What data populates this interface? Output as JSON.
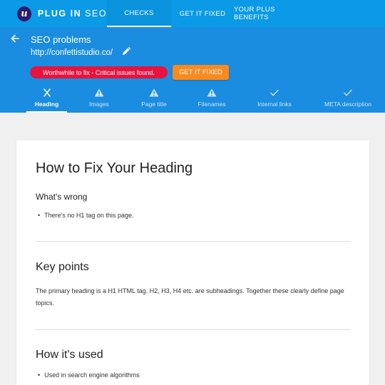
{
  "app": {
    "logo_letter": "u",
    "brand_bold": "PLUG IN",
    "brand_rest": "SEO"
  },
  "topnav": {
    "items": [
      {
        "label": "CHECKS",
        "active": true
      },
      {
        "label": "GET IT FIXED",
        "active": false
      },
      {
        "label": "YOUR PLUS BENEFITS",
        "active": false
      }
    ]
  },
  "header": {
    "title": "SEO problems",
    "url": "http://confettistudio.co/",
    "status_badge": "Worthwhile to fix - Critical issues found.",
    "fix_button": "GET IT FIXED"
  },
  "tabs": [
    {
      "label": "Heading",
      "icon": "close-icon",
      "active": true
    },
    {
      "label": "Images",
      "icon": "warning-icon",
      "active": false
    },
    {
      "label": "Page title",
      "icon": "warning-icon",
      "active": false
    },
    {
      "label": "Filenames",
      "icon": "warning-icon",
      "active": false
    },
    {
      "label": "Internal links",
      "icon": "check-icon",
      "active": false
    },
    {
      "label": "META description",
      "icon": "check-icon",
      "active": false
    }
  ],
  "content": {
    "title": "How to Fix Your Heading",
    "whats_wrong": {
      "heading": "What's wrong",
      "items": [
        "There's no H1 tag on this page."
      ]
    },
    "key_points": {
      "heading": "Key points",
      "text": "The primary heading is a H1 HTML tag. H2, H3, H4 etc. are subheadings. Together these clearly define page topics."
    },
    "how_used": {
      "heading": "How it's used",
      "items": [
        "Used in search engine algorithms"
      ]
    }
  },
  "colors": {
    "topbar": "#0a9ae6",
    "header": "#1b8de0",
    "badge": "#e6133f",
    "fix_button": "#f88a1e",
    "logo": "#2b1a6e"
  }
}
